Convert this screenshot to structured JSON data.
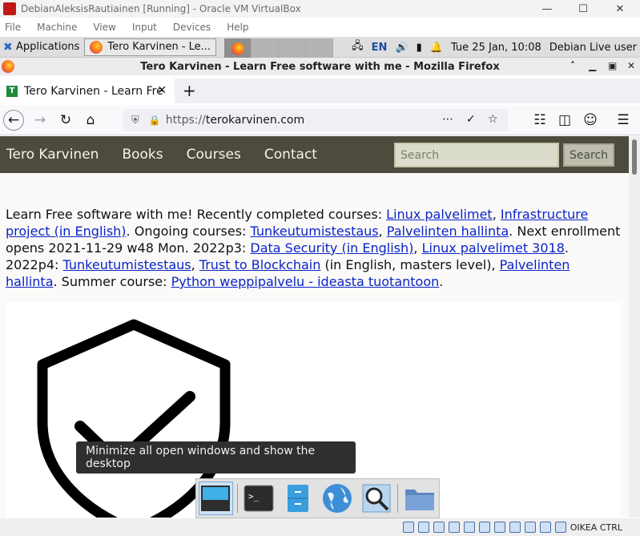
{
  "vbox": {
    "title": "DebianAleksisRautiainen [Running] - Oracle VM VirtualBox",
    "menu": [
      "File",
      "Machine",
      "View",
      "Input",
      "Devices",
      "Help"
    ],
    "status_host_key": "OIKEA CTRL"
  },
  "xfce": {
    "applications_label": "Applications",
    "task_label": "Tero Karvinen - Le...",
    "keyboard_layout": "EN",
    "clock": "Tue 25 Jan, 10:08",
    "user": "Debian Live user",
    "tooltip": "Minimize all open windows and show the desktop"
  },
  "firefox": {
    "window_title": "Tero Karvinen - Learn Free software with me - Mozilla Firefox",
    "tab_title": "Tero Karvinen - Learn Fre",
    "url_protocol": "https://",
    "url_host": "terokarvinen.com"
  },
  "site": {
    "nav": [
      "Tero Karvinen",
      "Books",
      "Courses",
      "Contact"
    ],
    "search_placeholder": "Search",
    "search_button": "Search",
    "intro": {
      "t1": "Learn Free software with me! Recently completed courses: ",
      "l1": "Linux palvelimet",
      "t2": ", ",
      "l2": "Infrastructure project (in English)",
      "t3": ". Ongoing courses: ",
      "l3": "Tunkeutumistestaus",
      "t4": ", ",
      "l4": "Palvelinten hallinta",
      "t5": ". Next enrollment opens 2021-11-29 w48 Mon. 2022p3: ",
      "l5": "Data Security (in English)",
      "t6": ", ",
      "l6": "Linux palvelimet 3018",
      "t7": ". 2022p4: ",
      "l7": "Tunkeutumistestaus",
      "t8": ", ",
      "l8": "Trust to Blockchain",
      "t9": " (in English, masters level), ",
      "l9": "Palvelinten hallinta",
      "t10": ". Summer course: ",
      "l10": "Python weppipalvelu - ideasta tuotantoon",
      "t11": "."
    }
  }
}
